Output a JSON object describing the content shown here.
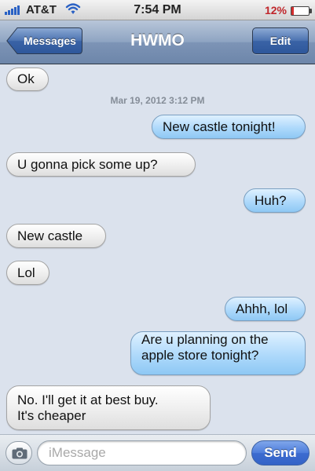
{
  "status_bar": {
    "carrier": "AT&T",
    "time": "7:54 PM",
    "battery_percent": "12%",
    "battery_level": 0.12,
    "battery_color": "#d42e2e"
  },
  "nav": {
    "back_label": "Messages",
    "title": "HWMO",
    "edit_label": "Edit"
  },
  "messages": [
    {
      "direction": "received",
      "text": "Ok"
    },
    {
      "type": "timestamp",
      "text": "Mar 19, 2012 3:12 PM"
    },
    {
      "direction": "sent",
      "text": "New castle tonight!"
    },
    {
      "direction": "received",
      "text": "U gonna pick some up?"
    },
    {
      "direction": "sent",
      "text": "Huh?"
    },
    {
      "direction": "received",
      "text": "New castle"
    },
    {
      "direction": "received",
      "text": "Lol"
    },
    {
      "direction": "sent",
      "text": "Ahhh, lol"
    },
    {
      "direction": "sent",
      "lines": [
        "Are u planning on the",
        "apple store tonight?"
      ]
    },
    {
      "direction": "received",
      "lines": [
        "No.  I'll get it at best buy.",
        "It's cheaper"
      ]
    }
  ],
  "compose": {
    "camera_icon": "camera-icon",
    "placeholder": "iMessage",
    "value": "",
    "send_label": "Send"
  },
  "colors": {
    "sent_bubble": "#aed9fb",
    "received_bubble": "#eeeeee",
    "accent": "#3c6cd0",
    "background": "#dbe2ed"
  }
}
